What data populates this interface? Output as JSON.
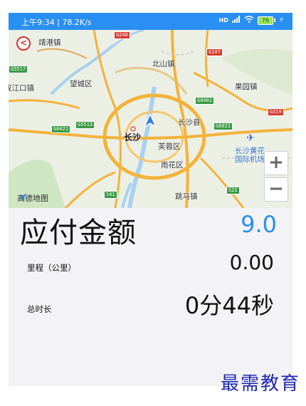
{
  "status_bar": {
    "left_text": "上午9:34 | 78.2K/s",
    "network": "HD",
    "battery": "76"
  },
  "map": {
    "labels": {
      "jinggang": "靖港镇",
      "beishan": "北山镇",
      "wangcheng": "望城区",
      "guoyuan": "果园镇",
      "jiangkou": "双江口镇",
      "changsha": "长沙",
      "changsha_county": "长沙县",
      "furong": "芙蓉区",
      "yuhua": "雨花区",
      "airport_1": "长沙黄花",
      "airport_2": "国际机场",
      "tiaoma": "跳马镇"
    },
    "roads": {
      "g240": "G240",
      "g107": "G107",
      "g5517": "G5517",
      "g0401": "G0401",
      "g0421": "G0421",
      "g5513": "G5513",
      "g6021": "G6021",
      "g319": "G319",
      "s41": "S41",
      "s21": "S21"
    },
    "zoom_in": "+",
    "zoom_out": "−",
    "logo": "高德地图"
  },
  "fare": {
    "title": "应付金额",
    "value": "9.0"
  },
  "mileage": {
    "label": "里程（公里）",
    "value": "0.00"
  },
  "duration": {
    "label": "总时长",
    "value": "0分44秒"
  },
  "watermark": "最需教育",
  "colors": {
    "accent": "#2a8ff2",
    "back_icon": "#d8322a",
    "watermark": "#1f27b0"
  }
}
